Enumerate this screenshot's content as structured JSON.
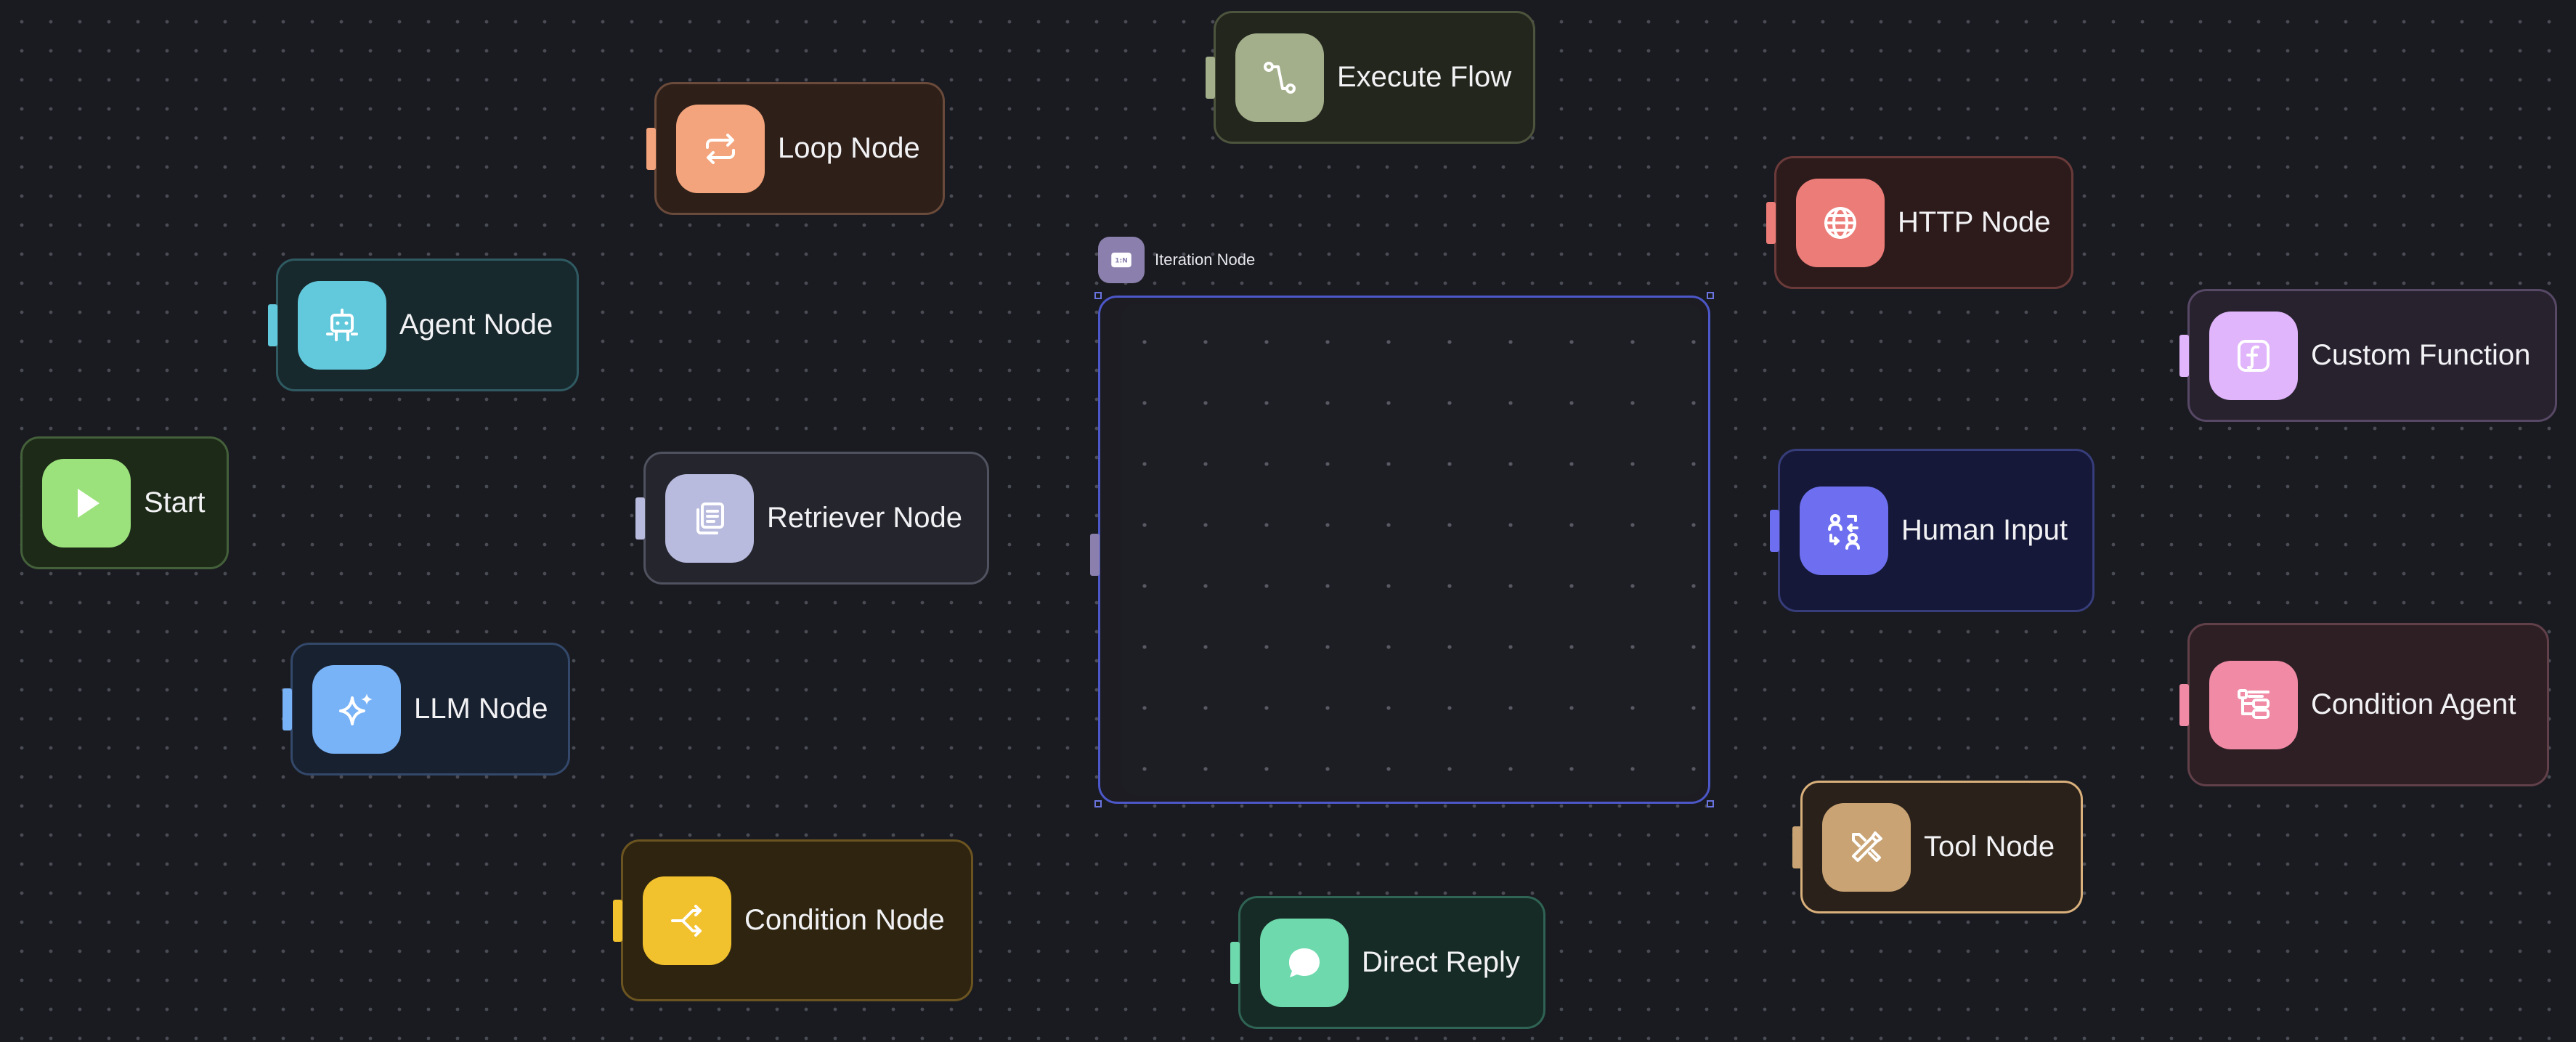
{
  "nodes": {
    "start": {
      "label": "Start"
    },
    "agent": {
      "label": "Agent Node"
    },
    "llm": {
      "label": "LLM Node"
    },
    "loop": {
      "label": "Loop Node"
    },
    "retriever": {
      "label": "Retriever Node"
    },
    "condition": {
      "label": "Condition Node"
    },
    "execute_flow": {
      "label": "Execute Flow"
    },
    "direct_reply": {
      "label": "Direct Reply"
    },
    "http": {
      "label": "HTTP Node"
    },
    "human_input": {
      "label": "Human Input"
    },
    "tool": {
      "label": "Tool Node"
    },
    "custom_function": {
      "label": "Custom Function"
    },
    "condition_agent": {
      "label": "Condition Agent"
    }
  },
  "iteration": {
    "label": "Iteration Node",
    "icon_text": "1:N"
  },
  "icons": {
    "start": "play-icon",
    "agent": "robot-icon",
    "llm": "sparkles-icon",
    "loop": "repeat-icon",
    "retriever": "documents-icon",
    "condition": "split-arrows-icon",
    "execute_flow": "flow-path-icon",
    "direct_reply": "chat-bubble-icon",
    "http": "globe-icon",
    "human_input": "users-exchange-icon",
    "tool": "tools-icon",
    "custom_function": "function-icon",
    "condition_agent": "branch-tree-icon"
  },
  "colors": {
    "start": "#9ce27c",
    "agent": "#62c8dc",
    "llm": "#78b2f7",
    "loop": "#f4a47c",
    "retriever": "#b8bade",
    "condition": "#f2c12e",
    "execute_flow": "#a3ae8a",
    "direct_reply": "#6ed9ad",
    "http": "#ec7c78",
    "human_input": "#6d6ff0",
    "tool": "#c9a373",
    "custom_function": "#e0b5fb",
    "condition_agent": "#f08aa5",
    "iteration": "#8b80ad",
    "selection": "#4c57c8"
  }
}
